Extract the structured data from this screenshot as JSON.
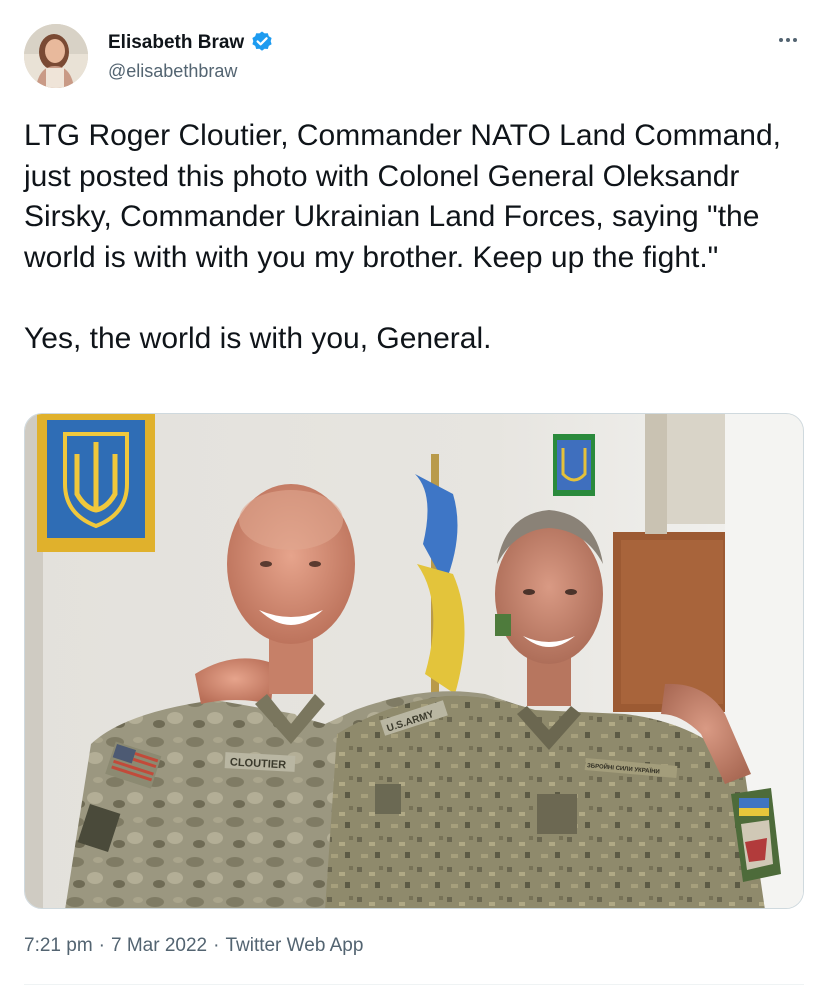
{
  "author": {
    "display_name": "Elisabeth Braw",
    "handle": "@elisabethbraw",
    "verified": true
  },
  "tweet": {
    "text": "LTG Roger Cloutier, Commander NATO Land Command, just posted this photo with Colonel General Oleksandr Sirsky, Commander Ukrainian Land Forces, saying \"the world is with with you my brother. Keep up the fight.\"\n\nYes, the world is with you, General.",
    "time": "7:21 pm",
    "date": "7 Mar 2022",
    "source": "Twitter Web App",
    "separator": "·"
  },
  "photo": {
    "name_tape": "CLOUTIER",
    "branch_tape": "U.S.ARMY",
    "ua_name_tape": "ЗБРОЙНІ СИЛИ УКРАЇНИ"
  },
  "colors": {
    "accent": "#1d9bf0",
    "text": "#0f1419",
    "secondary": "#536471",
    "border": "#cfd9de"
  },
  "icons": {
    "verified": "verified-badge-icon",
    "more": "more-options-icon"
  }
}
